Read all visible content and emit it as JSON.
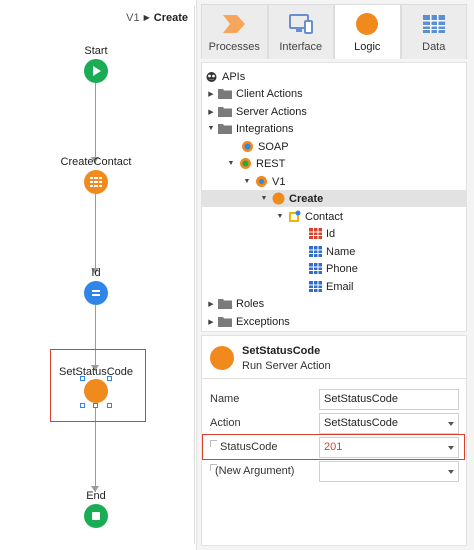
{
  "breadcrumb": {
    "parent": "V1",
    "current": "Create"
  },
  "flow": {
    "start_label": "Start",
    "create_label": "CreateContact",
    "assign_label": "Id",
    "server_label": "SetStatusCode",
    "end_label": "End"
  },
  "tabs": [
    {
      "label": "Processes",
      "icon": "processes-icon"
    },
    {
      "label": "Interface",
      "icon": "interface-icon"
    },
    {
      "label": "Logic",
      "icon": "logic-icon"
    },
    {
      "label": "Data",
      "icon": "data-icon"
    }
  ],
  "active_tab": "Logic",
  "tree": {
    "apis": "APIs",
    "client_actions": "Client Actions",
    "server_actions": "Server Actions",
    "integrations": "Integrations",
    "soap": "SOAP",
    "rest": "REST",
    "v1": "V1",
    "create": "Create",
    "contact": "Contact",
    "id": "Id",
    "name": "Name",
    "phone": "Phone",
    "email": "Email",
    "roles": "Roles",
    "exceptions": "Exceptions"
  },
  "properties": {
    "title": "SetStatusCode",
    "subtitle": "Run Server Action",
    "name_label": "Name",
    "name_value": "SetStatusCode",
    "action_label": "Action",
    "action_value": "SetStatusCode",
    "statuscode_label": "StatusCode",
    "statuscode_value": "201",
    "newarg_label": "(New Argument)",
    "newarg_value": ""
  },
  "colors": {
    "accent_orange": "#f08a1c",
    "start_green": "#1aad55",
    "assign_blue": "#2f86e8",
    "highlight_red": "#d9402a"
  }
}
